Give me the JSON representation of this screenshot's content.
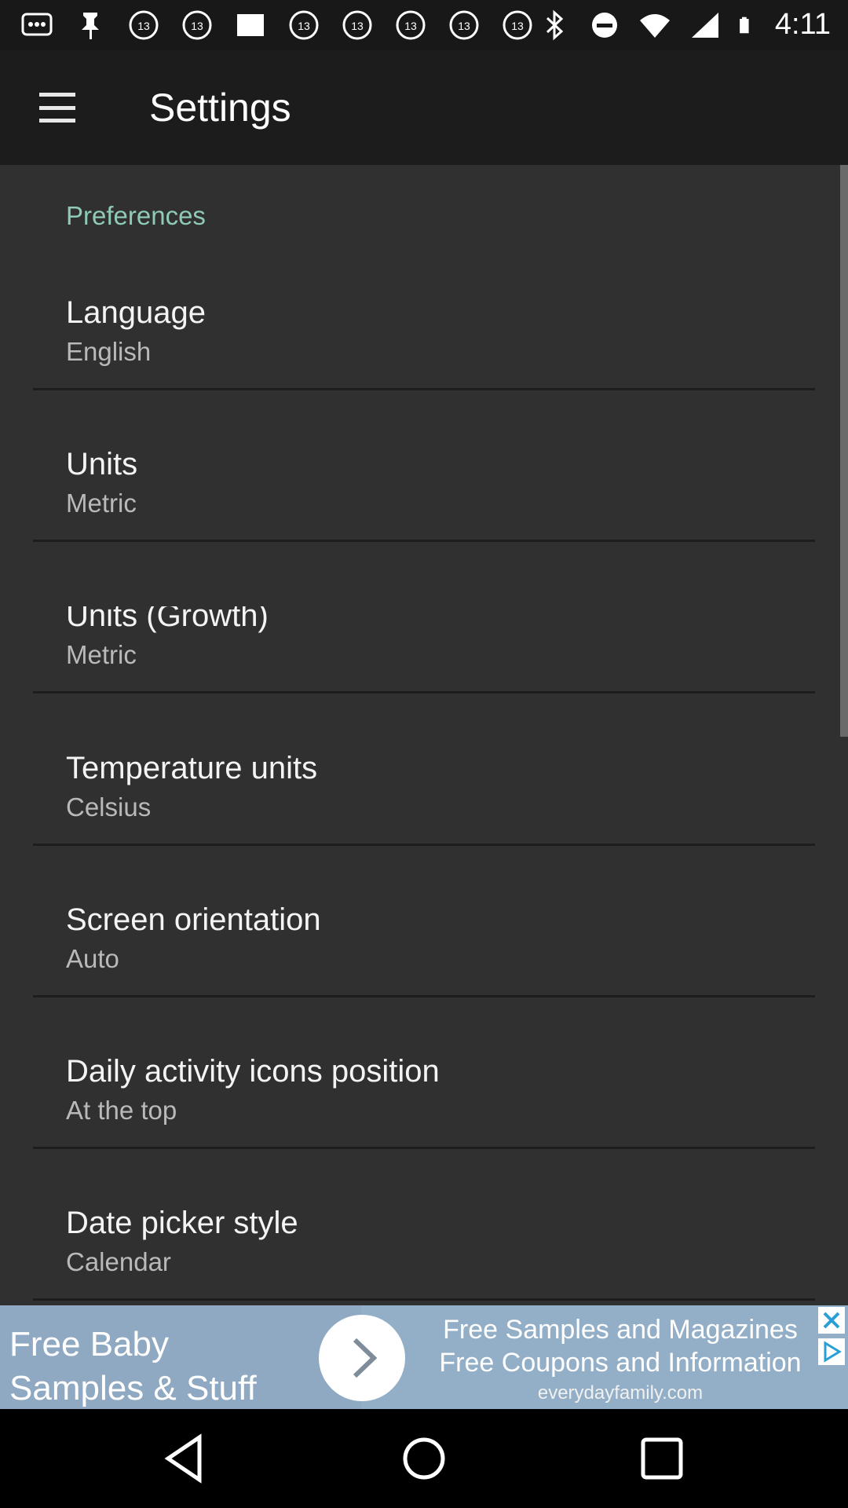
{
  "status_bar": {
    "time": "4:11",
    "left_icons": [
      "messages-icon",
      "pin-icon",
      "abc13-icon",
      "abc13-icon",
      "image-icon",
      "abc13-icon",
      "abc13-icon",
      "abc13-icon",
      "abc13-icon",
      "abc13-icon"
    ],
    "right_icons": [
      "bluetooth-icon",
      "dnd-icon",
      "wifi-icon",
      "signal-icon",
      "battery-icon"
    ]
  },
  "app_bar": {
    "title": "Settings"
  },
  "preferences": {
    "header": "Preferences",
    "items": [
      {
        "title": "Language",
        "value": "English"
      },
      {
        "title": "Units",
        "value": "Metric"
      },
      {
        "title": "Units (Growth)",
        "value": "Metric"
      },
      {
        "title": "Temperature units",
        "value": "Celsius"
      },
      {
        "title": "Screen orientation",
        "value": "Auto"
      },
      {
        "title": "Daily activity icons position",
        "value": "At the top"
      },
      {
        "title": "Date picker style",
        "value": "Calendar"
      }
    ]
  },
  "ad": {
    "left_text_line1": "Free Baby",
    "left_text_line2": "Samples & Stuff",
    "right_line1": "Free Samples and Magazines",
    "right_line2": "Free Coupons and Information",
    "url": "everydayfamily.com"
  },
  "colors": {
    "accent": "#8fc9b7",
    "background": "#303030",
    "app_bar": "#1c1c1c",
    "ad_background": "#93afc7"
  }
}
